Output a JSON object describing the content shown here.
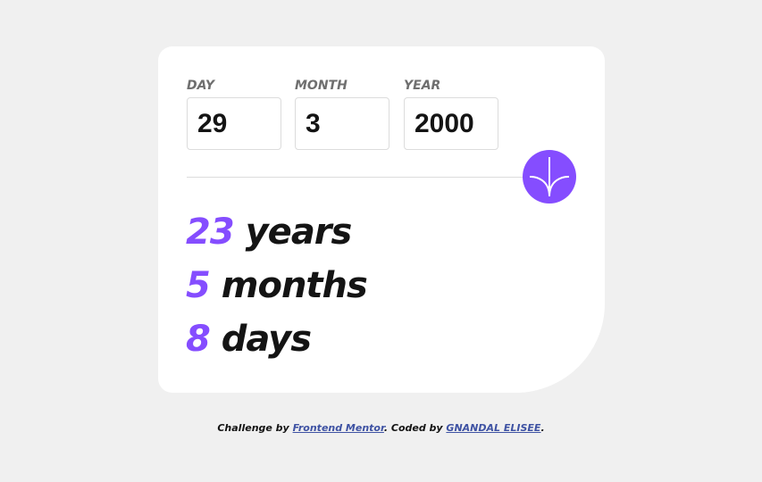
{
  "form": {
    "day": {
      "label": "DAY",
      "value": "29"
    },
    "month": {
      "label": "MONTH",
      "value": "3"
    },
    "year": {
      "label": "YEAR",
      "value": "2000"
    }
  },
  "submit": {
    "icon": "arrow-down-icon"
  },
  "results": {
    "years": {
      "value": "23",
      "unit": "years"
    },
    "months": {
      "value": "5",
      "unit": "months"
    },
    "days": {
      "value": "8",
      "unit": "days"
    }
  },
  "footer": {
    "prefix": "Challenge by ",
    "link1": "Frontend Mentor",
    "middle": ". Coded by ",
    "link2": "GNANDAL ELISEE",
    "suffix": "."
  },
  "colors": {
    "accent": "#854dff",
    "background": "#f0f0f0",
    "card": "#ffffff",
    "label": "#6f6f6f",
    "text": "#141414",
    "link": "#3e52a3"
  }
}
